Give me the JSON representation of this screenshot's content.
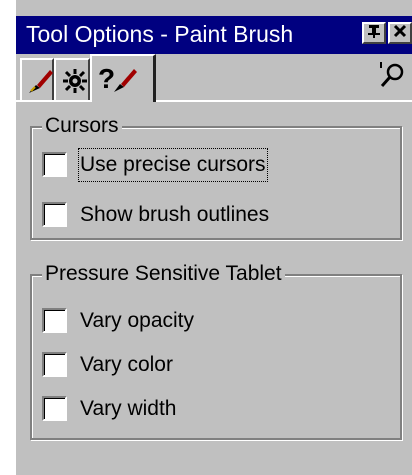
{
  "window": {
    "title": "Tool Options - Paint Brush",
    "title_buttons": [
      "pin",
      "close"
    ]
  },
  "tabs": [
    {
      "icon": "paint-brush-icon",
      "active": false
    },
    {
      "icon": "settings-icon",
      "active": false
    },
    {
      "icon": "help-brush-icon",
      "active": true
    }
  ],
  "toolbar_icon": "zoom-icon",
  "cursors_group": {
    "legend": "Cursors",
    "options": [
      {
        "label": "Use precise cursors",
        "checked": false
      },
      {
        "label": "Show brush outlines",
        "checked": false
      }
    ]
  },
  "tablet_group": {
    "legend": "Pressure Sensitive Tablet",
    "options": [
      {
        "label": "Vary opacity",
        "checked": false
      },
      {
        "label": "Vary color",
        "checked": false
      },
      {
        "label": "Vary width",
        "checked": false
      }
    ]
  },
  "colors": {
    "titlebar": "#000080",
    "face": "#c0c0c0"
  }
}
